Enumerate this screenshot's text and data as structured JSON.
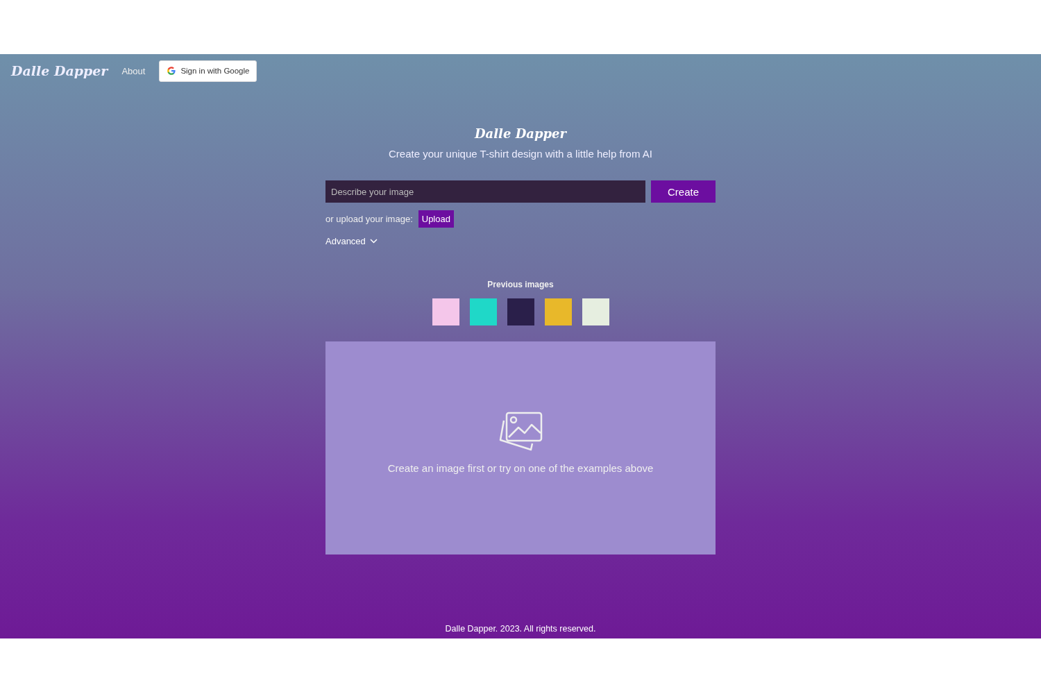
{
  "nav": {
    "logo": "Dalle Dapper",
    "links": [
      "About"
    ],
    "sign_in": "Sign in with Google"
  },
  "hero": {
    "title": "Dalle Dapper",
    "subtitle": "Create your unique T-shirt design with a little help from AI"
  },
  "prompt": {
    "placeholder": "Describe your image",
    "button": "Create"
  },
  "upload": {
    "label": "or upload your image:",
    "button": "Upload"
  },
  "advanced": {
    "label": "Advanced",
    "expanded": false
  },
  "previous": {
    "title": "Previous images",
    "thumbnails": [
      {
        "color": "#f4c6ea"
      },
      {
        "color": "#1fd8c8"
      },
      {
        "color": "#2a1f4a"
      },
      {
        "color": "#e8b82a"
      },
      {
        "color": "#e6eee0"
      }
    ]
  },
  "preview": {
    "message": "Create an image first or try on one of the examples above"
  },
  "footer": "Dalle Dapper. 2023. All rights reserved."
}
